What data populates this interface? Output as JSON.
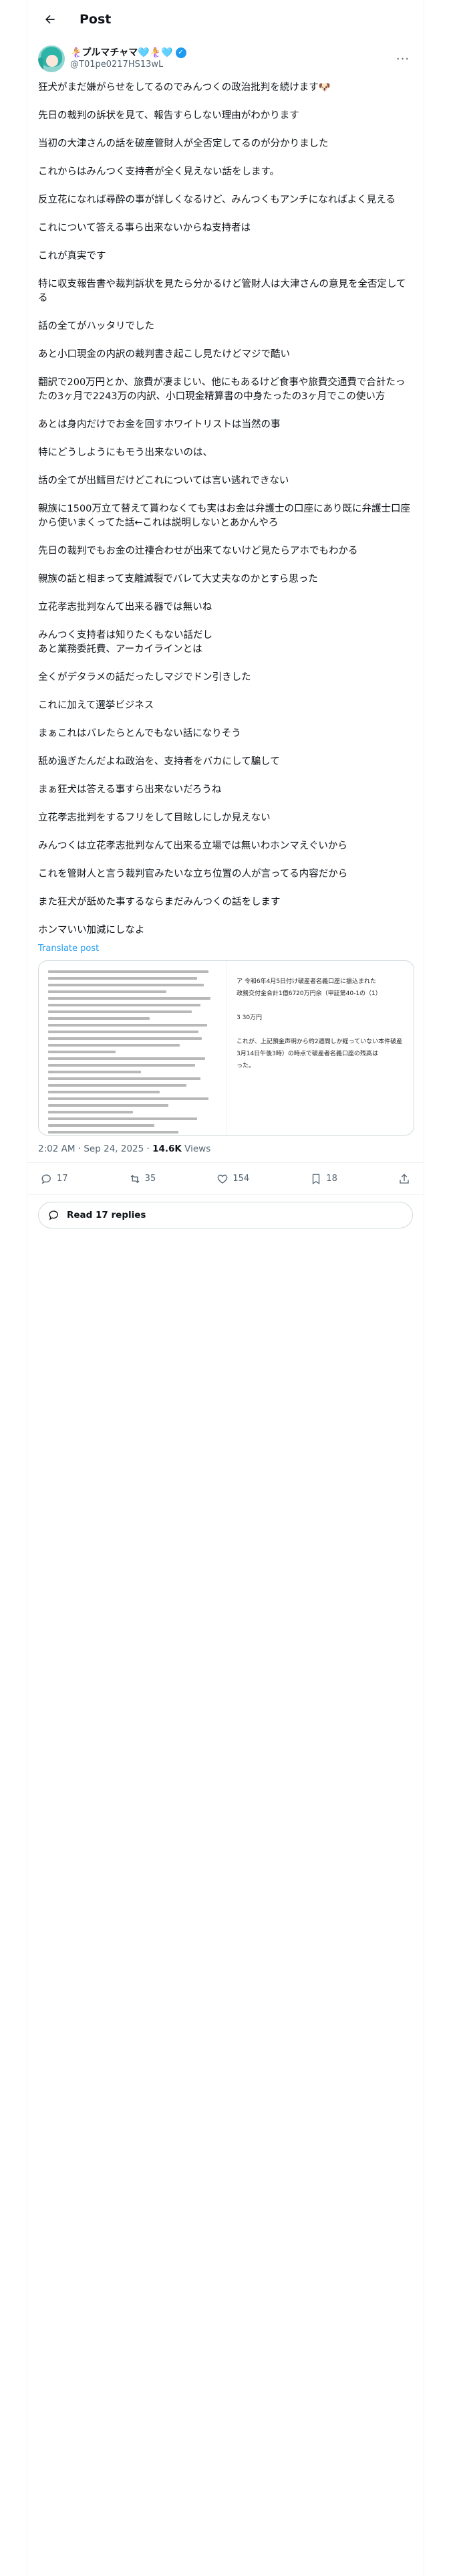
{
  "header": {
    "title": "Post"
  },
  "author": {
    "display_name": "🧜‍♀️プルマチャマ🩵🧜‍♀️🩵",
    "handle": "@T01pe0217HS13wL"
  },
  "paragraphs": [
    "狂犬がまだ嫌がらせをしてるのでみんつくの政治批判を続けます🐶",
    "先日の裁判の訴状を見て、報告すらしない理由がわかります",
    "当初の大津さんの話を破産管財人が全否定してるのが分かりました",
    "これからはみんつく支持者が全く見えない話をします。",
    "反立花になれば尋酔の事が詳しくなるけど、みんつくもアンチになればよく見える",
    "これについて答える事ら出来ないからね支持者は",
    "これが真実です",
    "特に収支報告書や裁判訴状を見たら分かるけど管財人は大津さんの意見を全否定してる",
    "話の全てがハッタリでした",
    "あと小口現金の内訳の裁判書き起こし見たけどマジで酷い",
    "翻訳で200万円とか、旅費が凄まじい、他にもあるけど食事や旅費交通費で合計たったの3ヶ月で2243万の内訳、小口現金精算書の中身たったの3ヶ月でこの使い方",
    "あとは身内だけでお金を回すホワイトリストは当然の事",
    "特にどうしようにもモう出来ないのは、",
    "話の全てが出鱈目だけどこれについては言い逃れできない",
    "親族に1500万立て替えて貰わなくても実はお金は弁護士の口座にあり既に弁護士口座から使いまくってた話←これは説明しないとあかんやろ",
    "先日の裁判でもお金の辻褄合わせが出来てないけど見たらアホでもわかる",
    "親族の話と相まって支離滅裂でバレて大丈夫なのかとすら思った",
    "立花孝志批判なんて出来る器では無いね",
    "みんつく支持者は知りたくもない話だし\nあと業務委託費、アーカイラインとは",
    "全くがデタラメの話だったしマジでドン引きした",
    "これに加えて選挙ビジネス",
    "まぁこれはバレたらとんでもない話になりそう",
    "舐め過ぎたんだよね政治を、支持者をバカにして騙して",
    "まぁ狂犬は答える事すら出来ないだろうね",
    "立花孝志批判をするフリをして目眩しにしか見えない",
    "みんつくは立花孝志批判なんて出来る立場では無いわホンマえぐいから",
    "これを管財人と言う裁判官みたいな立ち位置の人が言ってる内容だから",
    "また狂犬が舐めた事するならまだみんつくの話をします",
    "ホンマいい加減にしなよ"
  ],
  "translate_label": "Translate post",
  "media": {
    "right_lines": [
      "ア  令和6年4月5日付け破産者名義口座に振込まれた",
      "       政務交付金合計1億6720万円余（甲証第40-1の（1）",
      "",
      "3  30万円",
      "",
      "これが、上記預金声明から約2週間しか経っていない本件破産",
      "3月14日午後3時）の時点で破産者名義口座の残高は",
      "った。"
    ]
  },
  "meta": {
    "time": "2:02 AM · Sep 24, 2025 · ",
    "views_count": "14.6K",
    "views_label": " Views"
  },
  "actions": {
    "replies": "17",
    "reposts": "35",
    "likes": "154",
    "bookmarks": "18"
  },
  "read_replies": "Read 17 replies"
}
